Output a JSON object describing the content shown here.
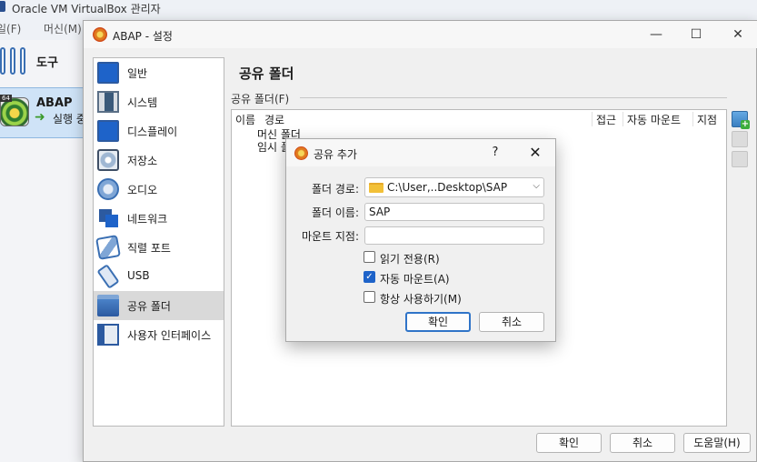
{
  "manager": {
    "title": "Oracle VM VirtualBox 관리자",
    "menu": [
      "일(F)",
      "머신(M)"
    ],
    "tools_label": "도구",
    "vm": {
      "name": "ABAP",
      "state": "실행 중",
      "badge": "64"
    }
  },
  "settings": {
    "title": "ABAP - 설정",
    "page_title": "공유 폴더",
    "nav": [
      {
        "label": "일반",
        "icon": "general-icon"
      },
      {
        "label": "시스템",
        "icon": "chip-icon"
      },
      {
        "label": "디스플레이",
        "icon": "display-icon"
      },
      {
        "label": "저장소",
        "icon": "storage-icon"
      },
      {
        "label": "오디오",
        "icon": "audio-icon"
      },
      {
        "label": "네트워크",
        "icon": "network-icon"
      },
      {
        "label": "직렬 포트",
        "icon": "serial-port-icon"
      },
      {
        "label": "USB",
        "icon": "usb-icon"
      },
      {
        "label": "공유 폴더",
        "icon": "shared-folder-icon",
        "selected": true
      },
      {
        "label": "사용자 인터페이스",
        "icon": "user-interface-icon"
      }
    ],
    "folders_group_label": "공유 폴더(F)",
    "columns": {
      "name": "이름",
      "path": "경로",
      "access": "접근",
      "automount": "자동 마운트",
      "at": "지점"
    },
    "tree": [
      "머신 폴더",
      "임시 폴"
    ],
    "buttons": {
      "ok": "확인",
      "cancel": "취소",
      "help": "도움말(H)"
    }
  },
  "add_share": {
    "title": "공유 추가",
    "help": "?",
    "folder_path_label": "폴더 경로:",
    "folder_path_value": "C:\\User,..Desktop\\SAP",
    "folder_name_label": "폴더 이름:",
    "folder_name_value": "SAP",
    "mount_point_label": "마운트 지점:",
    "mount_point_value": "",
    "readonly_label": "읽기 전용(R)",
    "readonly": false,
    "automount_label": "자동 마운트(A)",
    "automount": true,
    "permanent_label": "항상 사용하기(M)",
    "permanent": false,
    "ok": "확인",
    "cancel": "취소"
  },
  "colors": {
    "selection": "#d9d9d9",
    "vm_selection": "#cfe3f7",
    "accent": "#1e63c9",
    "default_button": "#2f74c8"
  }
}
